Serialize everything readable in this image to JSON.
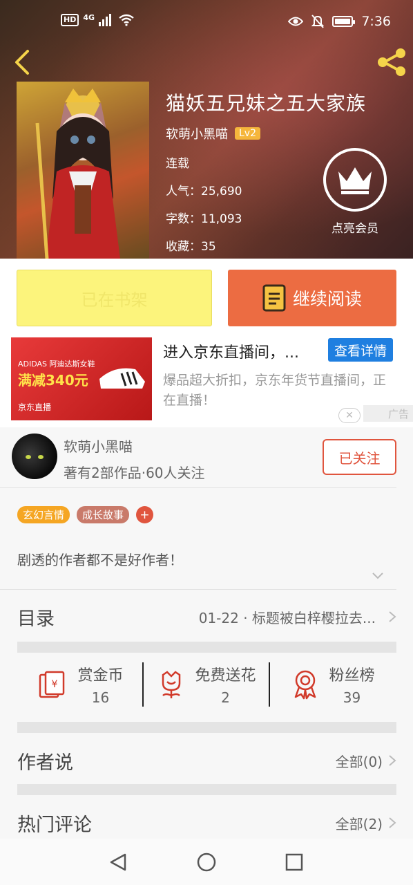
{
  "status_bar": {
    "hd": "HD",
    "network": "4G",
    "time": "7:36",
    "battery_level": 0.85
  },
  "book": {
    "title": "猫妖五兄妹之五大家族",
    "author": "软萌小黑喵",
    "level": "Lv2",
    "status": "连载",
    "popularity": "人气：25,690",
    "words": "字数：11,093",
    "favorites": "收藏：35"
  },
  "vip": {
    "label": "点亮会员"
  },
  "actions": {
    "shelf_label": "已在书架",
    "read_label": "继续阅读"
  },
  "ad": {
    "image_text_1": "ADIDAS 阿迪达斯女鞋",
    "image_text_2": "满减340元",
    "image_text_3": "京东直播",
    "title": "进入京东直播间，...",
    "detail_label": "查看详情",
    "description": "爆品超大折扣，京东年货节直播间，正在直播！",
    "tag": "广告",
    "close_label": "✕"
  },
  "author_card": {
    "name": "软萌小黑喵",
    "stats": "著有2部作品·60人关注",
    "follow_label": "已关注"
  },
  "tags": [
    {
      "label": "玄幻言情",
      "color": "#f5a623"
    },
    {
      "label": "成长故事",
      "color": "#c97a6a"
    }
  ],
  "tag_add": "+",
  "intro": "剧透的作者都不是好作者！",
  "catalog": {
    "label": "目录",
    "latest": "01-22 · 标题被白梓樱拉去..."
  },
  "stats": [
    {
      "label": "赏金币",
      "value": "16",
      "icon": "red-envelope-icon"
    },
    {
      "label": "免费送花",
      "value": "2",
      "icon": "flower-icon"
    },
    {
      "label": "粉丝榜",
      "value": "39",
      "icon": "medal-icon"
    }
  ],
  "author_says": {
    "label": "作者说",
    "value": "全部(0)"
  },
  "hot_comments": {
    "label": "热门评论",
    "value": "全部(2)"
  },
  "colors": {
    "accent": "#ec6c42",
    "shelf": "#fcf47c",
    "follow": "#e0553e",
    "ad_button": "#1f7fe0"
  }
}
